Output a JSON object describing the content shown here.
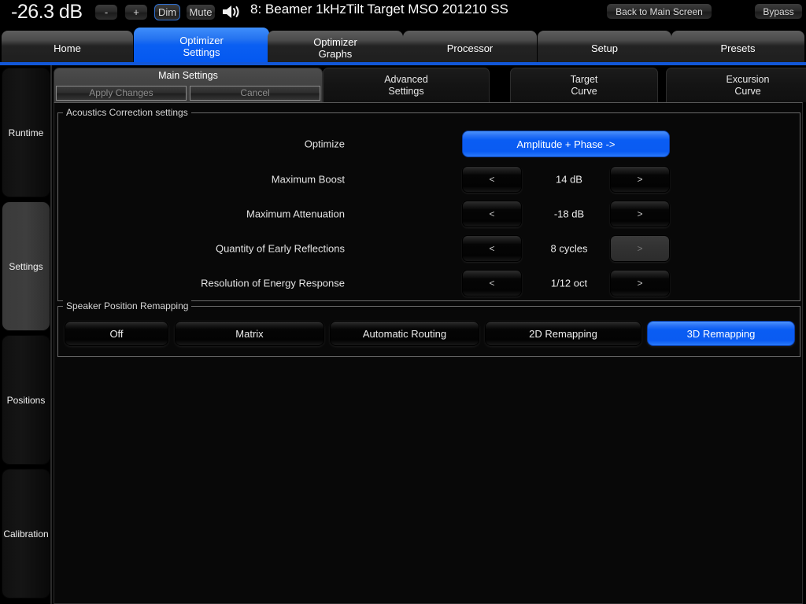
{
  "topbar": {
    "volume": "-26.3 dB",
    "minus_label": "-",
    "plus_label": "+",
    "dim_label": "Dim",
    "mute_label": "Mute",
    "speaker_icon": "speaker-volume-icon",
    "preset_title": "8: Beamer 1kHzTilt Target MSO 201210 SS",
    "back_label": "Back to Main Screen",
    "bypass_label": "Bypass"
  },
  "main_tabs": [
    {
      "line1": "Home",
      "line2": "",
      "active": false
    },
    {
      "line1": "Optimizer",
      "line2": "Settings",
      "active": true
    },
    {
      "line1": "Optimizer",
      "line2": "Graphs",
      "active": false
    },
    {
      "line1": "Processor",
      "line2": "",
      "active": false
    },
    {
      "line1": "Setup",
      "line2": "",
      "active": false
    },
    {
      "line1": "Presets",
      "line2": "",
      "active": false
    }
  ],
  "sidebar": {
    "items": [
      {
        "label": "Runtime",
        "active": false
      },
      {
        "label": "Settings",
        "active": true
      },
      {
        "label": "Positions",
        "active": false
      },
      {
        "label": "Calibration",
        "active": false
      }
    ]
  },
  "sub_tabs": [
    {
      "line1": "Main Settings",
      "line2": "",
      "active": true
    },
    {
      "line1": "Advanced",
      "line2": "Settings",
      "active": false
    },
    {
      "line1": "Target",
      "line2": "Curve",
      "active": false
    },
    {
      "line1": "Excursion",
      "line2": "Curve",
      "active": false
    }
  ],
  "actions": {
    "apply_label": "Apply Changes",
    "cancel_label": "Cancel"
  },
  "acoustics": {
    "group_label": "Acoustics Correction settings",
    "optimize": {
      "label": "Optimize",
      "value": "Amplitude + Phase ->"
    },
    "rows": [
      {
        "label": "Maximum Boost",
        "dec": "<",
        "value": "14 dB",
        "inc": ">",
        "inc_disabled": false
      },
      {
        "label": "Maximum Attenuation",
        "dec": "<",
        "value": "-18 dB",
        "inc": ">",
        "inc_disabled": false
      },
      {
        "label": "Quantity of Early Reflections",
        "dec": "<",
        "value": "8 cycles",
        "inc": ">",
        "inc_disabled": true
      },
      {
        "label": "Resolution of Energy Response",
        "dec": "<",
        "value": "1/12 oct",
        "inc": ">",
        "inc_disabled": false
      }
    ]
  },
  "remapping": {
    "group_label": "Speaker Position Remapping",
    "options": [
      {
        "label": "Off",
        "selected": false
      },
      {
        "label": "Matrix",
        "selected": false
      },
      {
        "label": "Automatic Routing",
        "selected": false
      },
      {
        "label": "2D Remapping",
        "selected": false
      },
      {
        "label": "3D Remapping",
        "selected": true
      }
    ]
  },
  "colors": {
    "accent_blue": "#0a5df3",
    "underline_blue": "#1257d8",
    "panel_bg": "#080808",
    "text": "#ececec"
  }
}
